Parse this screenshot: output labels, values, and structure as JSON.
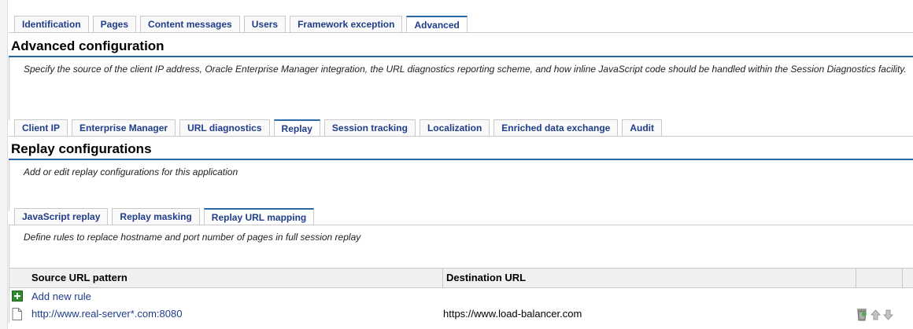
{
  "top_tabs": [
    {
      "label": "Identification",
      "active": false
    },
    {
      "label": "Pages",
      "active": false
    },
    {
      "label": "Content messages",
      "active": false
    },
    {
      "label": "Users",
      "active": false
    },
    {
      "label": "Framework exception",
      "active": false
    },
    {
      "label": "Advanced",
      "active": true
    }
  ],
  "advanced": {
    "title": "Advanced configuration",
    "description": "Specify the source of the client IP address, Oracle Enterprise Manager integration, the URL diagnostics reporting scheme, and how inline JavaScript code should be handled within the Session Diagnostics facility."
  },
  "sub_tabs": [
    {
      "label": "Client IP",
      "active": false
    },
    {
      "label": "Enterprise Manager",
      "active": false
    },
    {
      "label": "URL diagnostics",
      "active": false
    },
    {
      "label": "Replay",
      "active": true
    },
    {
      "label": "Session tracking",
      "active": false
    },
    {
      "label": "Localization",
      "active": false
    },
    {
      "label": "Enriched data exchange",
      "active": false
    },
    {
      "label": "Audit",
      "active": false
    }
  ],
  "replay": {
    "title": "Replay configurations",
    "description": "Add or edit replay configurations for this application"
  },
  "replay_tabs": [
    {
      "label": "JavaScript replay",
      "active": false
    },
    {
      "label": "Replay masking",
      "active": false
    },
    {
      "label": "Replay URL mapping",
      "active": true
    }
  ],
  "mapping": {
    "description": "Define rules to replace hostname and port number of pages in full session replay",
    "columns": {
      "source": "Source URL pattern",
      "destination": "Destination URL"
    },
    "add_label": "Add new rule",
    "rows": [
      {
        "source": "http://www.real-server*.com:8080",
        "destination": "https://www.load-balancer.com"
      }
    ]
  },
  "icons": {
    "add": "plus-icon",
    "row": "document-icon",
    "delete": "trash-icon",
    "up": "arrow-up-icon",
    "down": "arrow-down-icon"
  },
  "colors": {
    "accent": "#2b66a6",
    "tab_text": "#1f3d8a",
    "add_green": "#2e8b2e"
  }
}
